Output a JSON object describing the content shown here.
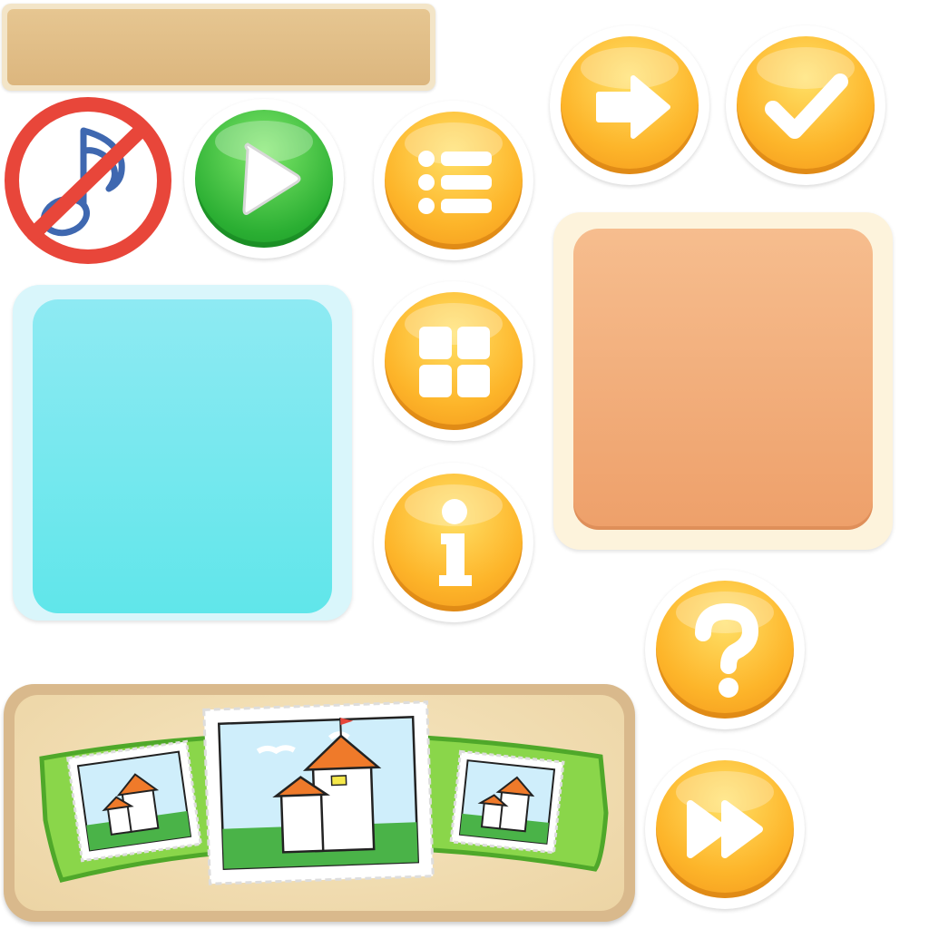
{
  "colors": {
    "gold_light": "#ffd23f",
    "gold_dark": "#f59a1a",
    "green_light": "#5fdc4f",
    "green_dark": "#1ea52c",
    "panel_blue": "#6ee6ee",
    "panel_orange": "#f0aa74",
    "title_bar": "#e2bf87",
    "carousel_frame": "#d9b98c",
    "carousel_inner": "#f1ddb2",
    "ribbon_green": "#8ad64a",
    "no_sign_red": "#e8463a",
    "music_blue": "#3f68b0"
  },
  "icons": {
    "music_off": "music-off-icon",
    "play": "play-icon",
    "menu_list": "list-icon",
    "grid": "grid-icon",
    "info": "info-icon",
    "next": "arrow-right-icon",
    "confirm": "check-icon",
    "help": "question-icon",
    "fast_forward": "fast-forward-icon",
    "level_thumbnails": [
      "house-stamp-left",
      "house-stamp-center",
      "house-stamp-right"
    ]
  },
  "buttons": [
    {
      "id": "music-toggle",
      "icon": "music-off-icon"
    },
    {
      "id": "play",
      "icon": "play-icon"
    },
    {
      "id": "menu",
      "icon": "list-icon"
    },
    {
      "id": "level-grid",
      "icon": "grid-icon"
    },
    {
      "id": "info",
      "icon": "info-icon"
    },
    {
      "id": "next",
      "icon": "arrow-right-icon"
    },
    {
      "id": "confirm",
      "icon": "check-icon"
    },
    {
      "id": "help",
      "icon": "question-icon"
    },
    {
      "id": "skip",
      "icon": "fast-forward-icon"
    }
  ],
  "level_carousel": {
    "thumbnails": [
      "house-stamp-left",
      "house-stamp-center",
      "house-stamp-right"
    ],
    "selected": "house-stamp-center"
  }
}
